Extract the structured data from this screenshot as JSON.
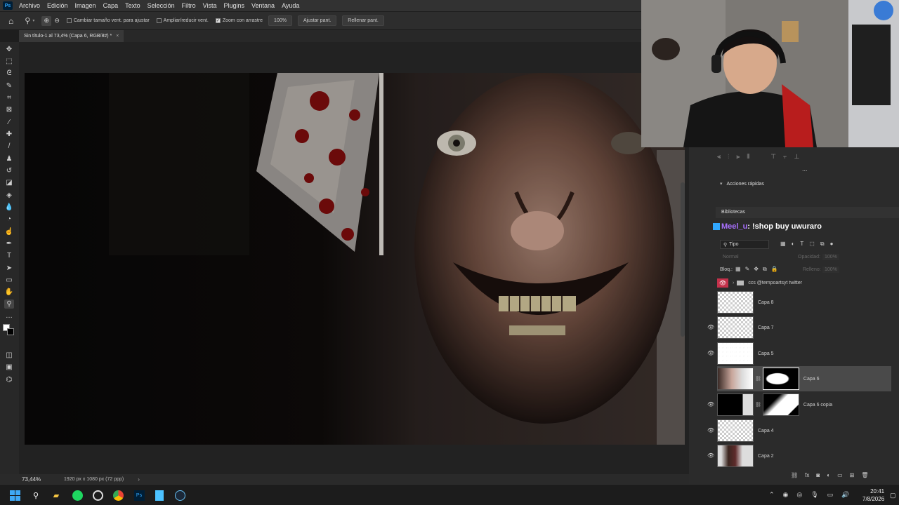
{
  "menubar": {
    "app_icon": "Ps",
    "items": [
      "Archivo",
      "Edición",
      "Imagen",
      "Capa",
      "Texto",
      "Selección",
      "Filtro",
      "Vista",
      "Plugins",
      "Ventana",
      "Ayuda"
    ]
  },
  "options": {
    "resize_windows": "Cambiar tamaño vent. para ajustar",
    "zoom_all": "Ampliar/reducir vent.",
    "scrubby_zoom": "Zoom con arrastre",
    "zoom_value": "100%",
    "fit_screen": "Ajustar pant.",
    "fill_screen": "Rellenar pant."
  },
  "document_tab": {
    "title": "Sin título-1 al 73,4% (Capa 6, RGB/8#) *",
    "close": "×"
  },
  "status": {
    "zoom": "73,44%",
    "doc_info": "1920 px x 1080 px (72 ppp)",
    "arrow": "›"
  },
  "quick_actions": {
    "title": "Acciones rápidas",
    "more": "..."
  },
  "libraries": {
    "title": "Bibliotecas"
  },
  "chat_overlay": {
    "user": "Meel_u",
    "message": ": !shop buy uwuraro"
  },
  "layers_panel": {
    "filter_kind": "Tipo",
    "blend_mode": "Normal",
    "opacity_label": "Opacidad:",
    "opacity_value": "100%",
    "lock_label": "Bloq.:",
    "fill_label": "Relleno:",
    "fill_value": "100%",
    "group_name": "ccs @tempoartsyt twitter",
    "layers": [
      {
        "name": "Capa 8",
        "visible": false
      },
      {
        "name": "Capa 7",
        "visible": true
      },
      {
        "name": "Capa 5",
        "visible": true
      },
      {
        "name": "Capa 6",
        "visible": false,
        "selected": true,
        "mask": true
      },
      {
        "name": "Capa 6 copia",
        "visible": true,
        "mask": true
      },
      {
        "name": "Capa 4",
        "visible": true
      },
      {
        "name": "Capa 2",
        "visible": true
      }
    ]
  },
  "taskbar": {
    "time": "20:41",
    "date": "7/8/2026",
    "icons": [
      "windows-icon",
      "search-icon",
      "explorer-icon",
      "spotify-icon",
      "obs-icon",
      "chrome-icon",
      "photoshop-icon",
      "notepad-icon",
      "steam-icon"
    ]
  },
  "colors": {
    "accent": "#31a8ff",
    "selected_layer": "#4a4a4a",
    "eye_active": "#c4314b"
  }
}
